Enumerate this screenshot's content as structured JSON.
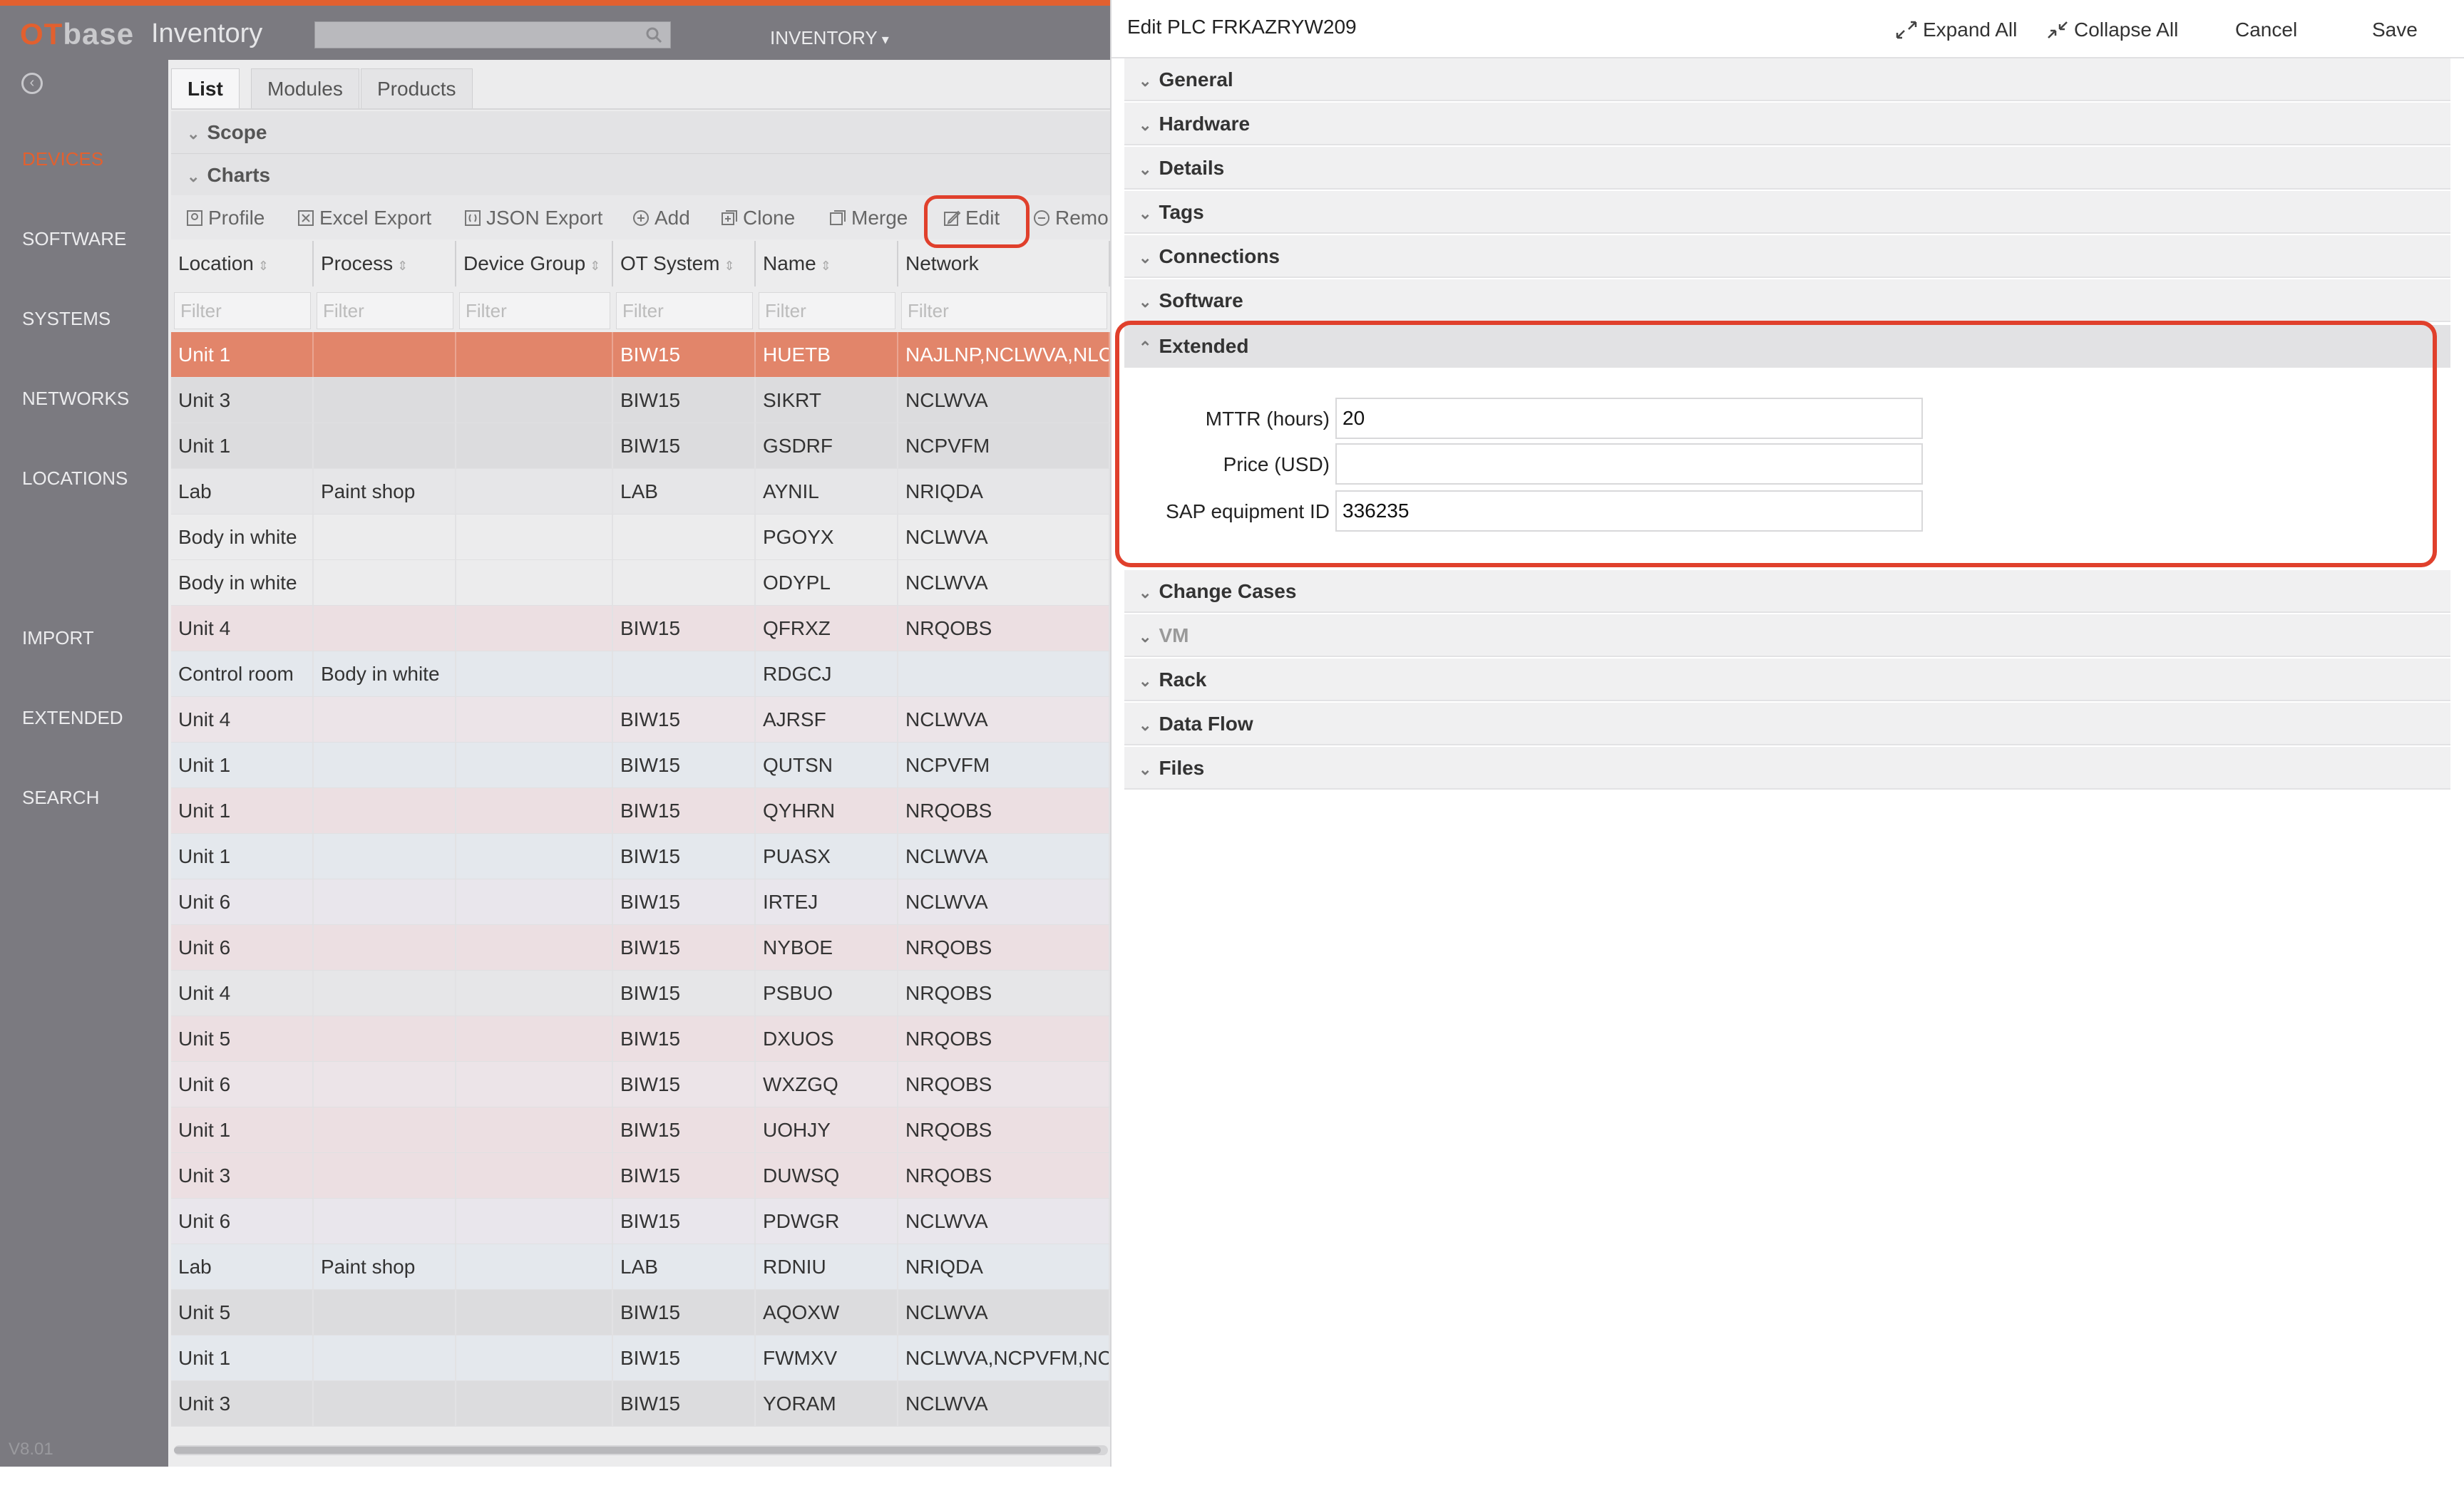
{
  "header": {
    "logo_ot": "OT",
    "logo_base": "base",
    "app_name": "Inventory",
    "search_value": "",
    "nav_label": "INVENTORY"
  },
  "sidebar": {
    "items": [
      "DEVICES",
      "SOFTWARE",
      "SYSTEMS",
      "NETWORKS",
      "LOCATIONS",
      "IMPORT",
      "EXTENDED",
      "SEARCH"
    ],
    "active": "DEVICES",
    "version": "V8.01"
  },
  "list": {
    "tabs": [
      "List",
      "Modules",
      "Products"
    ],
    "sections": [
      "Scope",
      "Charts"
    ],
    "toolbar": [
      "Profile",
      "Excel Export",
      "JSON Export",
      "Add",
      "Clone",
      "Merge",
      "Edit",
      "Remo"
    ],
    "columns": [
      "Location",
      "Process",
      "Device Group",
      "OT System",
      "Name",
      "Network"
    ],
    "filter_placeholder": "Filter",
    "rows": [
      [
        "Unit 1",
        "",
        "",
        "BIW15",
        "HUETB",
        "NAJLNP,NCLWVA,NLC"
      ],
      [
        "Unit 3",
        "",
        "",
        "BIW15",
        "SIKRT",
        "NCLWVA"
      ],
      [
        "Unit 1",
        "",
        "",
        "BIW15",
        "GSDRF",
        "NCPVFM"
      ],
      [
        "Lab",
        "Paint shop",
        "",
        "LAB",
        "AYNIL",
        "NRIQDA"
      ],
      [
        "Body in white",
        "",
        "",
        "",
        "PGOYX",
        "NCLWVA"
      ],
      [
        "Body in white",
        "",
        "",
        "",
        "ODYPL",
        "NCLWVA"
      ],
      [
        "Unit 4",
        "",
        "",
        "BIW15",
        "QFRXZ",
        "NRQOBS"
      ],
      [
        "Control room",
        "Body in white",
        "",
        "",
        "RDGCJ",
        ""
      ],
      [
        "Unit 4",
        "",
        "",
        "BIW15",
        "AJRSF",
        "NCLWVA"
      ],
      [
        "Unit 1",
        "",
        "",
        "BIW15",
        "QUTSN",
        "NCPVFM"
      ],
      [
        "Unit 1",
        "",
        "",
        "BIW15",
        "QYHRN",
        "NRQOBS"
      ],
      [
        "Unit 1",
        "",
        "",
        "BIW15",
        "PUASX",
        "NCLWVA"
      ],
      [
        "Unit 6",
        "",
        "",
        "BIW15",
        "IRTEJ",
        "NCLWVA"
      ],
      [
        "Unit 6",
        "",
        "",
        "BIW15",
        "NYBOE",
        "NRQOBS"
      ],
      [
        "Unit 4",
        "",
        "",
        "BIW15",
        "PSBUO",
        "NRQOBS"
      ],
      [
        "Unit 5",
        "",
        "",
        "BIW15",
        "DXUOS",
        "NRQOBS"
      ],
      [
        "Unit 6",
        "",
        "",
        "BIW15",
        "WXZGQ",
        "NRQOBS"
      ],
      [
        "Unit 1",
        "",
        "",
        "BIW15",
        "UOHJY",
        "NRQOBS"
      ],
      [
        "Unit 3",
        "",
        "",
        "BIW15",
        "DUWSQ",
        "NRQOBS"
      ],
      [
        "Unit 6",
        "",
        "",
        "BIW15",
        "PDWGR",
        "NCLWVA"
      ],
      [
        "Lab",
        "Paint shop",
        "",
        "LAB",
        "RDNIU",
        "NRIQDA"
      ],
      [
        "Unit 5",
        "",
        "",
        "BIW15",
        "AQOXW",
        "NCLWVA"
      ],
      [
        "Unit 1",
        "",
        "",
        "BIW15",
        "FWMXV",
        "NCLWVA,NCPVFM,NC"
      ],
      [
        "Unit 3",
        "",
        "",
        "BIW15",
        "YORAM",
        "NCLWVA"
      ]
    ],
    "row_colors": [
      "#e2856a",
      "#dcdcde",
      "#dcdcde",
      "#e6e6e8",
      "#ececed",
      "#ececed",
      "#ecdfe2",
      "#e4e8ed",
      "#ece4e8",
      "#e4e8ed",
      "#ecdfe2",
      "#e4e8ed",
      "#e9e6ec",
      "#ecdfe2",
      "#e6e6e8",
      "#ecdfe2",
      "#ece4e8",
      "#ecdfe2",
      "#ecdfe2",
      "#e9e6ec",
      "#e4e8ed",
      "#dcdcde",
      "#e4e8ed",
      "#dcdcde"
    ]
  },
  "editor": {
    "title": "Edit PLC FRKAZRYW209",
    "actions": [
      "Expand All",
      "Collapse All",
      "Cancel",
      "Save"
    ],
    "sections_before": [
      "General",
      "Hardware",
      "Details",
      "Tags",
      "Connections",
      "Software"
    ],
    "open_section": "Extended",
    "fields": [
      {
        "label": "MTTR (hours)",
        "value": "20"
      },
      {
        "label": "Price (USD)",
        "value": ""
      },
      {
        "label": "SAP equipment ID",
        "value": "336235"
      }
    ],
    "sections_after": [
      "Change Cases",
      "VM",
      "Rack",
      "Data Flow",
      "Files"
    ]
  },
  "colors": {
    "accent": "#e2602f",
    "highlight": "#e0402c",
    "sidebar": "#7b7a80"
  }
}
